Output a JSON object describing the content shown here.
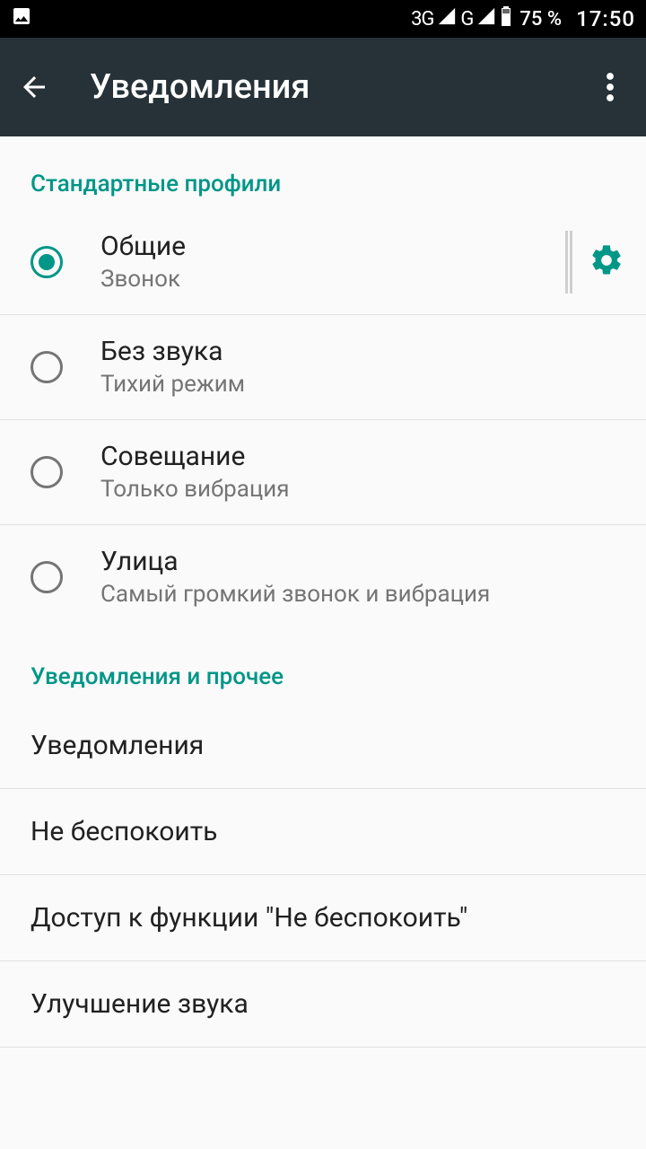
{
  "status": {
    "net1": "3G",
    "net2": "G",
    "battery": "75 %",
    "time": "17:50"
  },
  "appbar": {
    "title": "Уведомления"
  },
  "sections": {
    "profiles_header": "Стандартные профили",
    "other_header": "Уведомления и прочее"
  },
  "profiles": [
    {
      "title": "Общие",
      "sub": "Звонок",
      "selected": true,
      "hasGear": true
    },
    {
      "title": "Без звука",
      "sub": "Тихий режим",
      "selected": false,
      "hasGear": false
    },
    {
      "title": "Совещание",
      "sub": "Только вибрация",
      "selected": false,
      "hasGear": false
    },
    {
      "title": "Улица",
      "sub": "Самый громкий звонок и вибрация",
      "selected": false,
      "hasGear": false
    }
  ],
  "other": [
    {
      "label": "Уведомления"
    },
    {
      "label": "Не беспокоить"
    },
    {
      "label": "Доступ к функции \"Не беспокоить\""
    },
    {
      "label": "Улучшение звука"
    }
  ]
}
